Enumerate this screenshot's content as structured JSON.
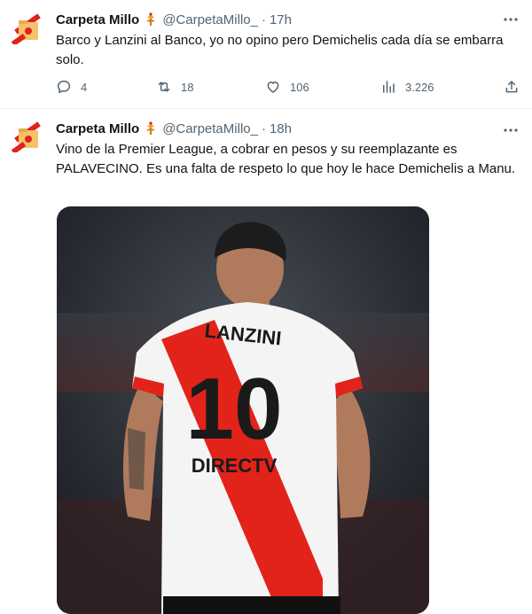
{
  "tweets": [
    {
      "author": "Carpeta Millo",
      "handle": "@CarpetaMillo_",
      "separator": "·",
      "time": "17h",
      "text": "Barco y Lanzini al Banco, yo no opino pero Demichelis cada día se embarra solo.",
      "replies": "4",
      "retweets": "18",
      "likes": "106",
      "views": "3.226"
    },
    {
      "author": "Carpeta Millo",
      "handle": "@CarpetaMillo_",
      "separator": "·",
      "time": "18h",
      "text": "Vino de la Premier League, a cobrar en pesos y su reemplazante es PALAVECINO. Es una falta de respeto lo que hoy le hace Demichelis a Manu.",
      "media": {
        "jersey_name": "LANZINI",
        "jersey_number": "10",
        "sponsor": "DIRECTV"
      }
    }
  ],
  "colors": {
    "text_primary": "#0f1419",
    "text_secondary": "#536471",
    "divider": "#eff3f4",
    "river_red": "#e2231a"
  },
  "icons": [
    "avatar-folder-icon",
    "verified-badge-icon",
    "more-icon",
    "reply-icon",
    "retweet-icon",
    "like-icon",
    "views-icon",
    "share-icon"
  ]
}
